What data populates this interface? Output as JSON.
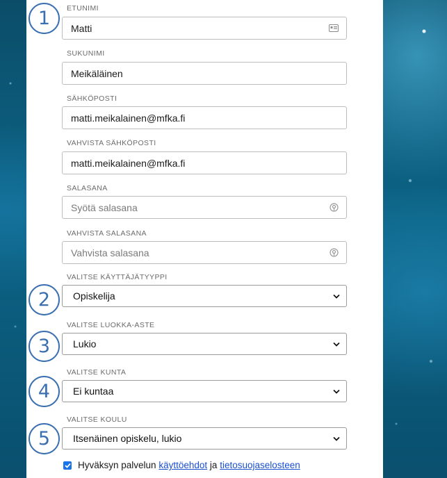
{
  "fields": {
    "first_name": {
      "label": "ETUNIMI",
      "value": "Matti"
    },
    "last_name": {
      "label": "SUKUNIMI",
      "value": "Meikäläinen"
    },
    "email": {
      "label": "SÄHKÖPOSTI",
      "value": "matti.meikalainen@mfka.fi"
    },
    "email_confirm": {
      "label": "VAHVISTA SÄHKÖPOSTI",
      "value": "matti.meikalainen@mfka.fi"
    },
    "password": {
      "label": "SALASANA",
      "placeholder": "Syötä salasana"
    },
    "password_confirm": {
      "label": "VAHVISTA SALASANA",
      "placeholder": "Vahvista salasana"
    }
  },
  "selects": {
    "user_type": {
      "label": "VALITSE KÄYTTÄJÄTYYPPI",
      "value": "Opiskelija"
    },
    "grade": {
      "label": "VALITSE LUOKKA-ASTE",
      "value": "Lukio"
    },
    "municipality": {
      "label": "VALITSE KUNTA",
      "value": "Ei kuntaa"
    },
    "school": {
      "label": "VALITSE KOULU",
      "value": "Itsenäinen opiskelu, lukio"
    }
  },
  "steps": [
    "1",
    "2",
    "3",
    "4",
    "5"
  ],
  "consent": {
    "checked": true,
    "prefix": "Hyväksyn palvelun",
    "terms_link": "käyttöehdot",
    "joiner": "ja",
    "privacy_link": "tietosuojaselosteen"
  },
  "colors": {
    "step_accent": "#3a6fb0",
    "link": "#1a4fd0",
    "checkbox": "#1a73e8"
  },
  "icons": {
    "first_name": "contact-card-icon",
    "password": "password-reveal-icon",
    "select": "chevron-down-icon"
  }
}
